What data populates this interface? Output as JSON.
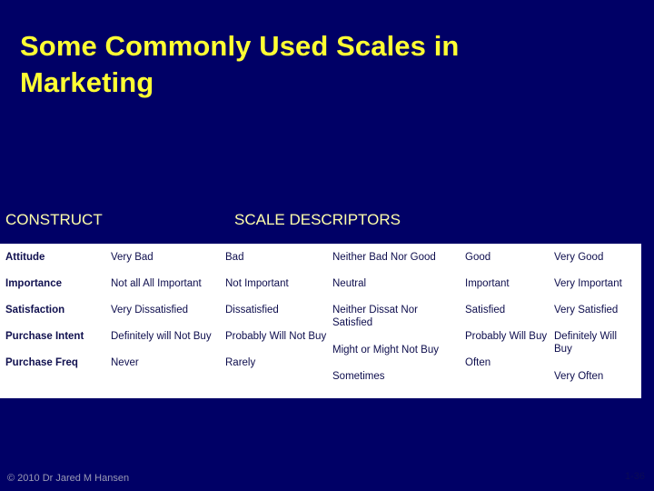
{
  "slide": {
    "title": "Some Commonly Used Scales in Marketing",
    "background_color": "#000066",
    "title_color": "#ffff33"
  },
  "table": {
    "headers": {
      "construct": "CONSTRUCT",
      "descriptors": "SCALE DESCRIPTORS"
    },
    "header_color": "#ffffaa",
    "band_color": "#ffffff",
    "text_color": "#0d0d4d",
    "rows": [
      {
        "construct": "Attitude",
        "descriptors": [
          "Very Bad",
          "Bad",
          "Neither Bad Nor Good",
          "Good",
          "Very Good"
        ]
      },
      {
        "construct": "Importance",
        "descriptors": [
          "Not all All Important",
          "Not Important",
          "Neutral",
          "Important",
          "Very Important"
        ]
      },
      {
        "construct": "Satisfaction",
        "descriptors": [
          "Very Dissatisfied",
          "Dissatisfied",
          "Neither Dissat Nor Satisfied",
          "Satisfied",
          "Very Satisfied"
        ]
      },
      {
        "construct": "Purchase Intent",
        "descriptors": [
          "Definitely will Not Buy",
          "Probably Will Not Buy",
          "Might or Might Not Buy",
          "Probably Will Buy",
          "Definitely Will Buy"
        ]
      },
      {
        "construct": "Purchase Freq",
        "descriptors": [
          "Never",
          "Rarely",
          "Sometimes",
          "Often",
          "Very Often"
        ]
      }
    ]
  },
  "footer": {
    "copyright": "© 2010 Dr Jared M Hansen",
    "page_number": "1-36"
  }
}
